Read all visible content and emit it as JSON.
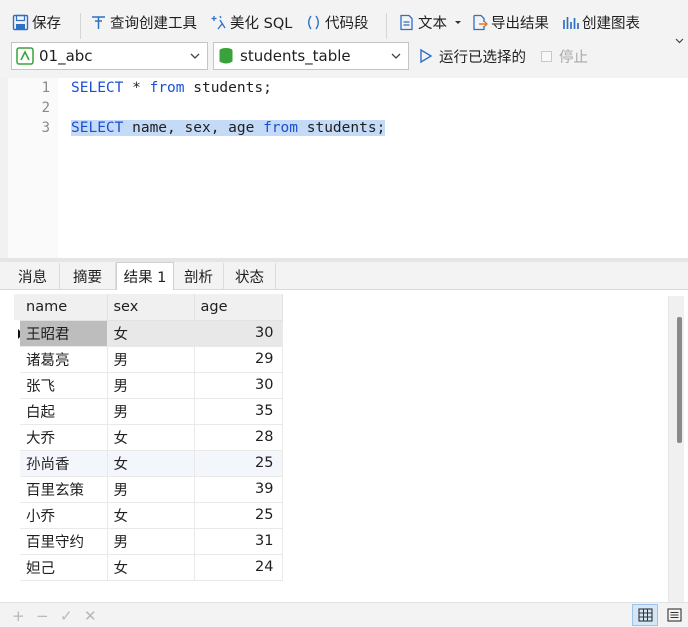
{
  "toolbar": {
    "save": "保存",
    "query_builder": "查询创建工具",
    "beautify_sql": "美化 SQL",
    "code_snippet": "代码段",
    "text": "文本",
    "export_results": "导出结果",
    "create_chart": "创建图表",
    "connection": "01_abc",
    "table": "students_table",
    "run_selected": "运行已选择的",
    "stop": "停止"
  },
  "editor": {
    "line_numbers": [
      "1",
      "2",
      "3"
    ],
    "line1": {
      "kw1": "SELECT",
      "mid": " * ",
      "kw2": "from",
      "tail": " students;"
    },
    "line3": {
      "kw1": "SELECT",
      "mid": " name, sex, age ",
      "kw2": "from",
      "tail": " students;"
    }
  },
  "result_tabs": [
    "消息",
    "摘要",
    "结果 1",
    "剖析",
    "状态"
  ],
  "active_tab": "结果 1",
  "grid": {
    "columns": [
      "name",
      "sex",
      "age"
    ],
    "rows": [
      [
        "王昭君",
        "女",
        "30"
      ],
      [
        "诸葛亮",
        "男",
        "29"
      ],
      [
        "张飞",
        "男",
        "30"
      ],
      [
        "白起",
        "男",
        "35"
      ],
      [
        "大乔",
        "女",
        "28"
      ],
      [
        "孙尚香",
        "女",
        "25"
      ],
      [
        "百里玄策",
        "男",
        "39"
      ],
      [
        "小乔",
        "女",
        "25"
      ],
      [
        "百里守约",
        "男",
        "31"
      ],
      [
        "妲己",
        "女",
        "24"
      ]
    ]
  },
  "statusbar": {
    "add": "+",
    "remove": "−",
    "apply": "✓",
    "discard": "✕"
  },
  "colors": {
    "keyword": "#1a4fd6",
    "selection": "#c4daf7",
    "toolbar_bg": "#f3f3f3"
  }
}
